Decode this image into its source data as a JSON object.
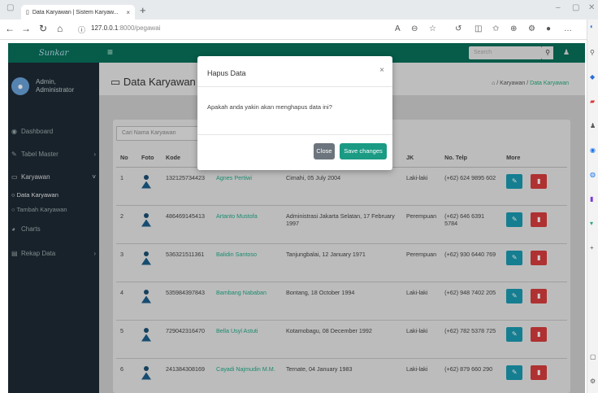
{
  "browser": {
    "tab_title": "Data Karyawan | Sistem Karyaw...",
    "url_host": "127.0.0.1",
    "url_path": ":8000/pegawai"
  },
  "app": {
    "brand": "Sunkar",
    "search_placeholder": "Search",
    "user_name": "Admin,",
    "user_role": "Administrator"
  },
  "sidebar": {
    "items": [
      {
        "label": "Dashboard"
      },
      {
        "label": "Tabel Master"
      },
      {
        "label": "Karyawan"
      },
      {
        "label": "Charts"
      },
      {
        "label": "Rekap Data"
      }
    ],
    "subitems": [
      {
        "label": "Data Karyawan"
      },
      {
        "label": "Tambah Karyawan"
      }
    ]
  },
  "page": {
    "title": "Data Karyawan",
    "crumb_home": "/ Karyawan /",
    "crumb_current": "Data Karyawan",
    "search_placeholder": "Cari Nama Karyawan"
  },
  "table": {
    "headers": [
      "No",
      "Foto",
      "Kode",
      "",
      "",
      "JK",
      "No. Telp",
      "More"
    ],
    "rows": [
      {
        "no": "1",
        "kode": "132125734423",
        "nama": "Agnes Pertiwi",
        "ttl": "Cimahi, 05 July 2004",
        "jk": "Laki-laki",
        "telp": "(+62) 624 9895 602"
      },
      {
        "no": "2",
        "kode": "486469145413",
        "nama": "Artanto Mustofa",
        "ttl": "Administrasi Jakarta Selatan, 17 February 1997",
        "jk": "Perempuan",
        "telp": "(+62) 646 6391 5784"
      },
      {
        "no": "3",
        "kode": "536321511361",
        "nama": "Balidin Santoso",
        "ttl": "Tanjungbalai, 12 January 1971",
        "jk": "Perempuan",
        "telp": "(+62) 930 6440 769"
      },
      {
        "no": "4",
        "kode": "535984397843",
        "nama": "Bambang Nababan",
        "ttl": "Bontang, 18 October 1994",
        "jk": "Laki-laki",
        "telp": "(+62) 948 7402 205"
      },
      {
        "no": "5",
        "kode": "729042316470",
        "nama": "Bella Usyl Astuti",
        "ttl": "Kotamobagu, 08 December 1992",
        "jk": "Laki-laki",
        "telp": "(+62) 782 5378 725"
      },
      {
        "no": "6",
        "kode": "241384308169",
        "nama": "Cayadi Najmudin M.M.",
        "ttl": "Ternate, 04 January 1983",
        "jk": "Laki-laki",
        "telp": "(+62) 879 660 290"
      }
    ]
  },
  "modal": {
    "title": "Hapus Data",
    "close_x": "×",
    "body": "Apakah anda yakin akan menghapus data ini?",
    "close_label": "Close",
    "save_label": "Save changes"
  },
  "colors": {
    "topnav": "#08705a",
    "sidebar": "#1e2a35",
    "edit_button": "#1a9ab1",
    "delete_button": "#d63c3c",
    "save_button": "#1b9a84"
  }
}
